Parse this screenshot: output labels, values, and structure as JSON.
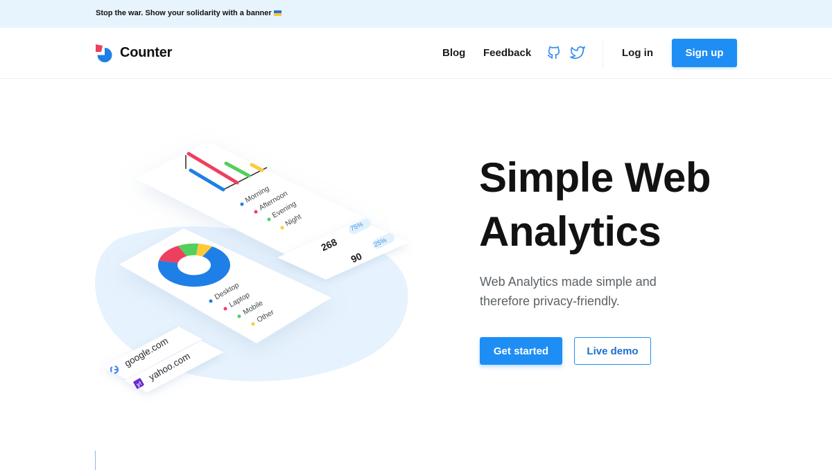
{
  "banner": {
    "text": "Stop the war. Show your solidarity with a banner"
  },
  "header": {
    "logo_text": "Counter",
    "nav": {
      "blog": "Blog",
      "feedback": "Feedback",
      "login": "Log in",
      "signup": "Sign up"
    },
    "icons": [
      "github-icon",
      "twitter-icon"
    ]
  },
  "hero": {
    "title_line1": "Simple Web",
    "title_line2": "Analytics",
    "subtitle_line1": "Web Analytics made simple and",
    "subtitle_line2": "therefore privacy-friendly.",
    "cta_primary": "Get started",
    "cta_secondary": "Live demo"
  },
  "illustration": {
    "bar_legend": [
      "Morning",
      "Afternoon",
      "Evening",
      "Night"
    ],
    "pie_legend": [
      "Desktop",
      "Laptop",
      "Mobile",
      "Other"
    ],
    "stats": [
      {
        "value": "268",
        "percent": "75%"
      },
      {
        "value": "90",
        "percent": "25%"
      }
    ],
    "referrers": [
      "google.com",
      "yahoo.com"
    ]
  },
  "colors": {
    "accent": "#1e8ef5",
    "banner_bg": "#e8f4fd",
    "blue": "#1e7fe6",
    "red": "#ef3f5e",
    "green": "#52cf5c",
    "yellow": "#ffc93a"
  }
}
